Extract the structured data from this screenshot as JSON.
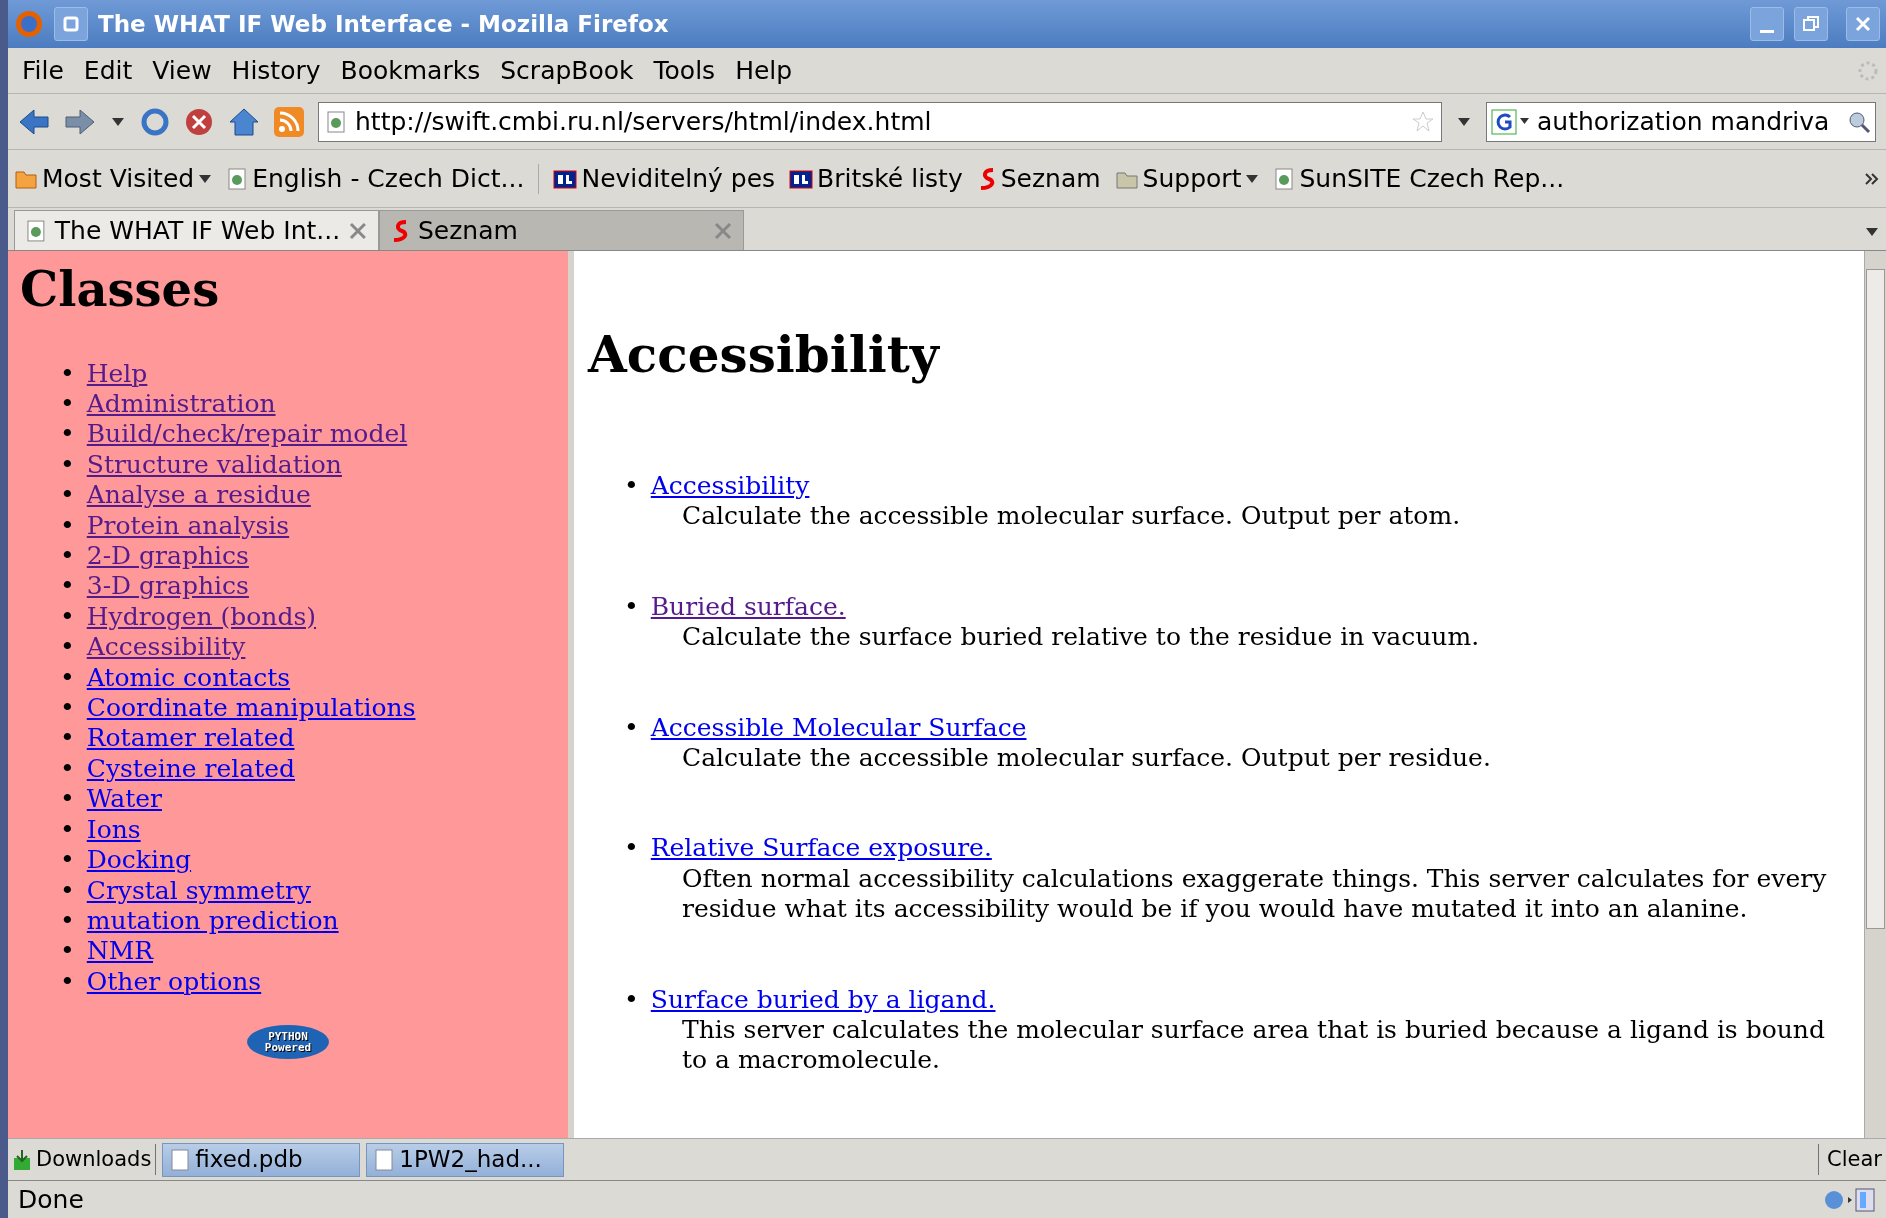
{
  "window": {
    "title": "The WHAT IF Web Interface - Mozilla Firefox"
  },
  "menu": [
    "File",
    "Edit",
    "View",
    "History",
    "Bookmarks",
    "ScrapBook",
    "Tools",
    "Help"
  ],
  "address": {
    "value": "http://swift.cmbi.ru.nl/servers/html/index.html"
  },
  "search": {
    "value": "authorization mandriva"
  },
  "bookmarks": [
    {
      "label": "Most Visited",
      "kind": "menu"
    },
    {
      "label": "English - Czech Dict...",
      "kind": "page"
    },
    {
      "label": "Neviditelný pes",
      "kind": "bl"
    },
    {
      "label": "Britské listy",
      "kind": "bl"
    },
    {
      "label": "Seznam",
      "kind": "s"
    },
    {
      "label": "Support",
      "kind": "folder"
    },
    {
      "label": "SunSITE Czech Rep...",
      "kind": "page"
    }
  ],
  "tabs": [
    {
      "label": "The WHAT IF Web Int...",
      "selected": true,
      "kind": "page"
    },
    {
      "label": "Seznam",
      "selected": false,
      "kind": "s"
    }
  ],
  "sidebar": {
    "title": "Classes",
    "items": [
      {
        "bullet": "•",
        "label": "Help",
        "visited": true
      },
      {
        "bullet": "•",
        "label": "Administration",
        "visited": true
      },
      {
        "bullet": "•",
        "label": "Build/check/repair model",
        "visited": true
      },
      {
        "bullet": "•",
        "label": "Structure validation",
        "visited": true
      },
      {
        "bullet": "•",
        "label": "Analyse a residue",
        "visited": true
      },
      {
        "bullet": "•",
        "label": "Protein analysis",
        "visited": true
      },
      {
        "bullet": "•",
        "label": "2-D graphics",
        "visited": true
      },
      {
        "bullet": "•",
        "label": "3-D graphics",
        "visited": true
      },
      {
        "bullet": "•",
        "label": "Hydrogen (bonds)",
        "visited": true
      },
      {
        "bullet": "•",
        "label": "Accessibility",
        "visited": true
      },
      {
        "bullet": "•",
        "label": "Atomic contacts",
        "visited": false
      },
      {
        "bullet": "•",
        "label": "Coordinate manipulations",
        "visited": false
      },
      {
        "bullet": "•",
        "label": "Rotamer related",
        "visited": false
      },
      {
        "bullet": "•",
        "label": "Cysteine related",
        "visited": false
      },
      {
        "bullet": "•",
        "label": "Water",
        "visited": false
      },
      {
        "bullet": "•",
        "label": "Ions",
        "visited": false
      },
      {
        "bullet": "•",
        "label": "Docking",
        "visited": false
      },
      {
        "bullet": "•",
        "label": "Crystal symmetry",
        "visited": false
      },
      {
        "bullet": "•",
        "label": "mutation prediction",
        "visited": false
      },
      {
        "bullet": "•",
        "label": "NMR",
        "visited": false
      },
      {
        "bullet": "•",
        "label": "Other options",
        "visited": false
      }
    ],
    "badge": [
      "PYTHON",
      "Powered"
    ]
  },
  "main": {
    "title": "Accessibility",
    "items": [
      {
        "bullet": "•",
        "label": "Accessibility",
        "visited": false,
        "description": "Calculate the accessible molecular surface. Output per atom."
      },
      {
        "bullet": "•",
        "label": "Buried surface.",
        "visited": true,
        "description": "Calculate the surface buried relative to the residue in vacuum."
      },
      {
        "bullet": "•",
        "label": "Accessible Molecular Surface",
        "visited": false,
        "description": "Calculate the accessible molecular surface. Output per residue."
      },
      {
        "bullet": "•",
        "label": "Relative Surface exposure.",
        "visited": false,
        "description": "Often normal accessibility calculations exaggerate things. This server calculates for every residue what its accessibility would be if you would have mutated it into an alanine."
      },
      {
        "bullet": "•",
        "label": "Surface buried by a ligand.",
        "visited": false,
        "description": "This server calculates the molecular surface area that is buried because a ligand is bound to a macromolecule."
      }
    ]
  },
  "downloads": {
    "label": "Downloads",
    "files": [
      "fixed.pdb",
      "1PW2_had..."
    ],
    "clear": "Clear"
  },
  "status_bar": "Done"
}
